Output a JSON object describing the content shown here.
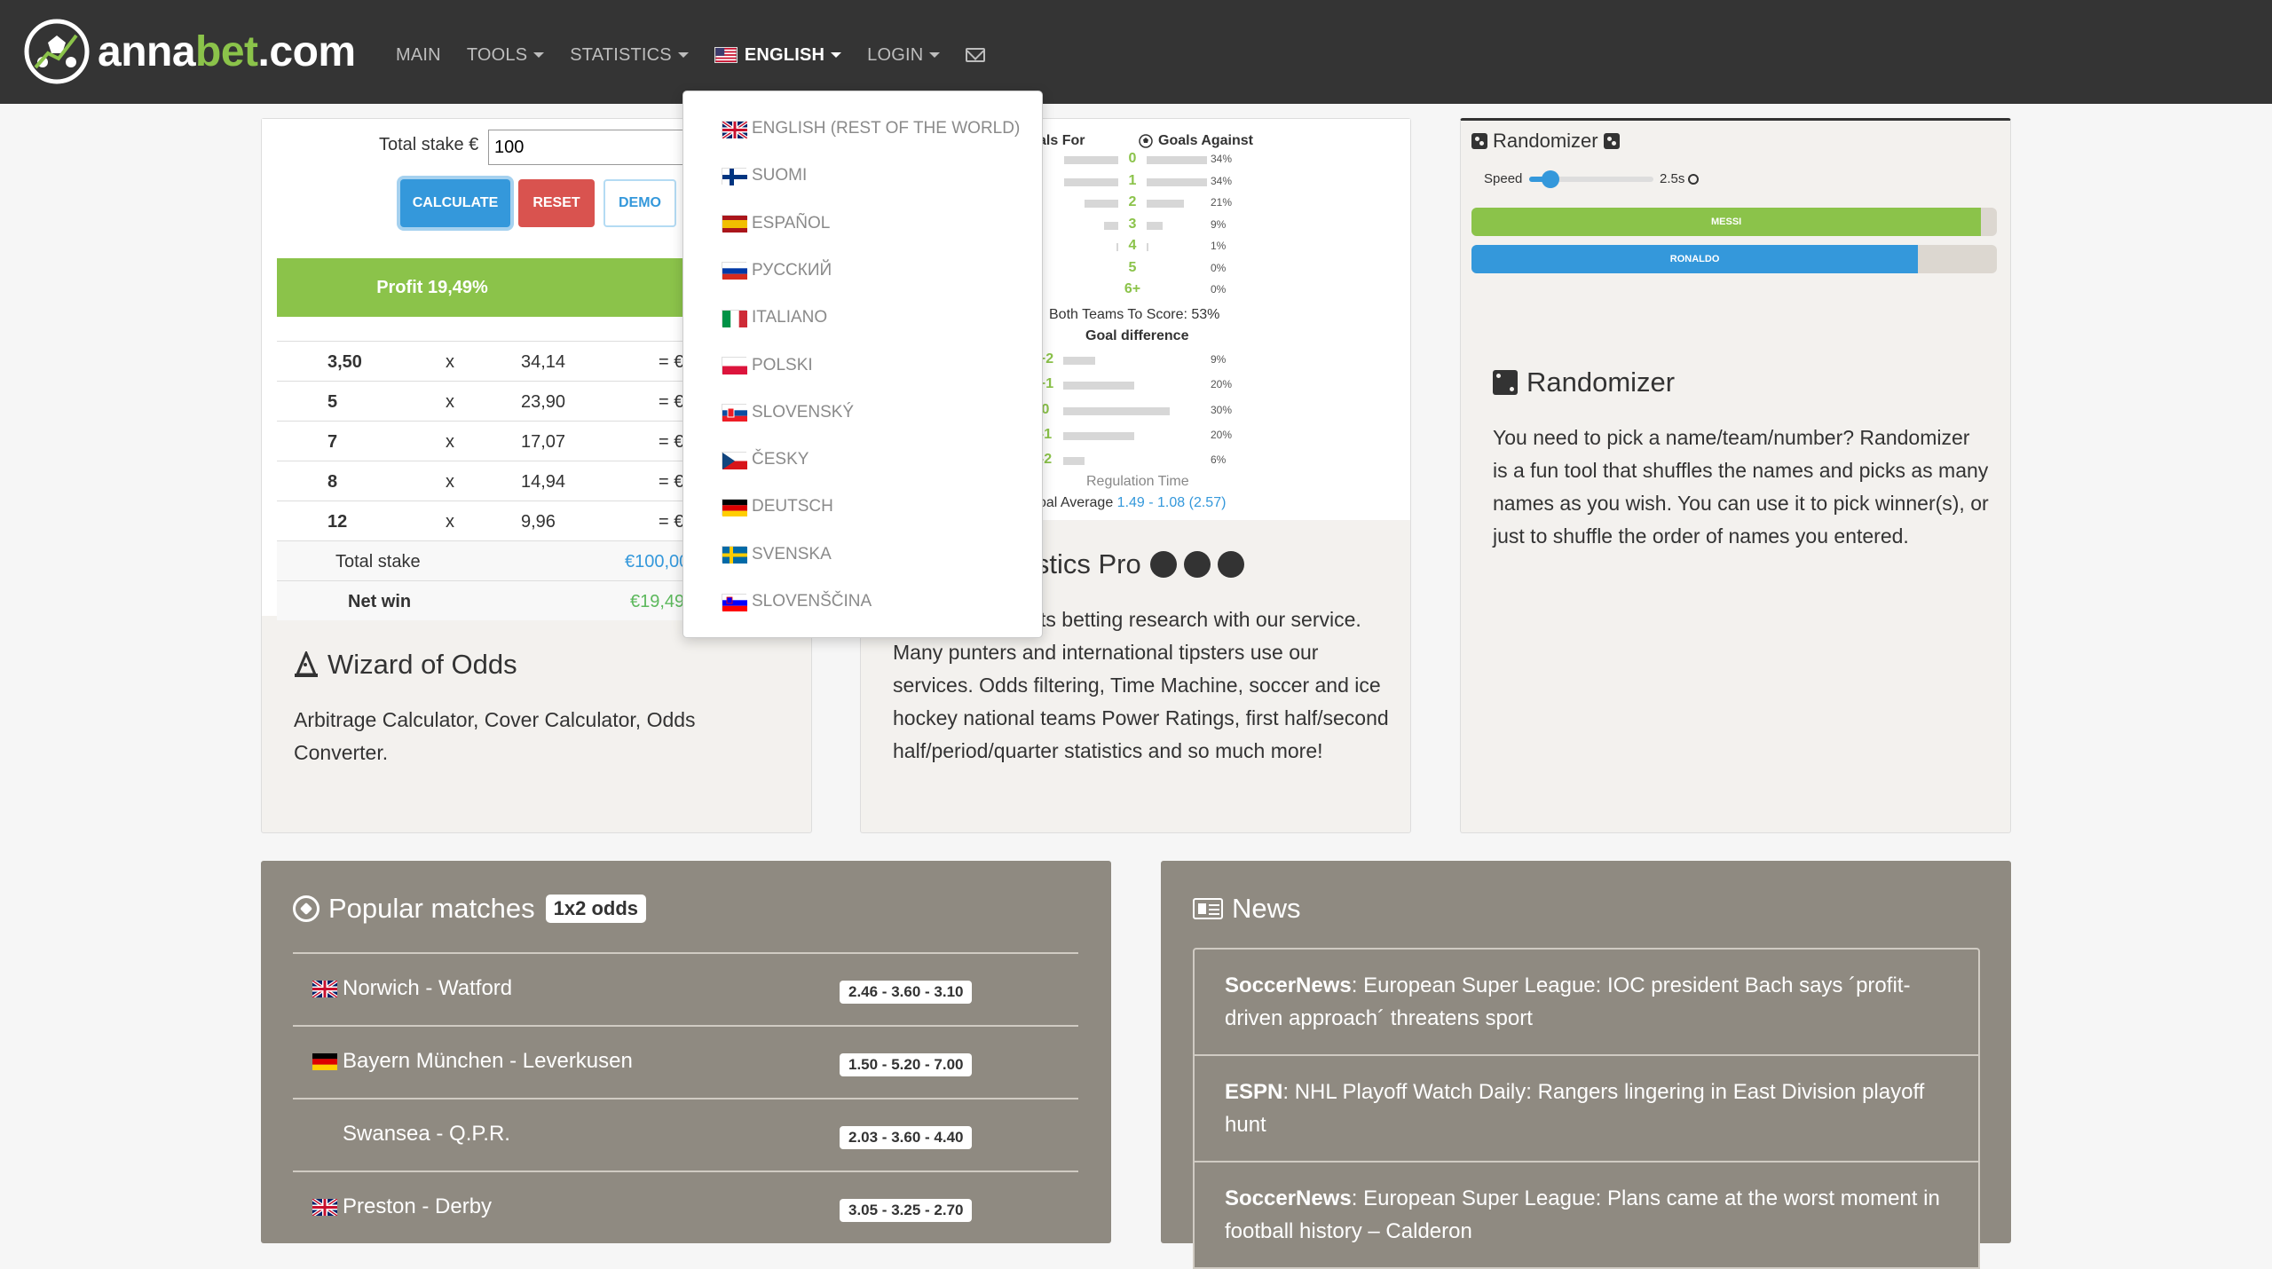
{
  "brand": {
    "name_plain": "anna",
    "name_accent": "bet",
    "name_suffix": ".com"
  },
  "nav": {
    "main": "MAIN",
    "tools": "TOOLS",
    "statistics": "STATISTICS",
    "language": "ENGLISH",
    "login": "LOGIN"
  },
  "languages": [
    {
      "label": "ENGLISH (REST OF THE WORLD)",
      "flag": "gb"
    },
    {
      "label": "SUOMI",
      "flag": "fi"
    },
    {
      "label": "ESPAÑOL",
      "flag": "es"
    },
    {
      "label": "РУССКИЙ",
      "flag": "ru"
    },
    {
      "label": "ITALIANO",
      "flag": "it"
    },
    {
      "label": "POLSKI",
      "flag": "pl"
    },
    {
      "label": "SLOVENSKÝ",
      "flag": "sk"
    },
    {
      "label": "ČESKY",
      "flag": "cz"
    },
    {
      "label": "DEUTSCH",
      "flag": "de"
    },
    {
      "label": "SVENSKA",
      "flag": "se"
    },
    {
      "label": "SLOVENŠČINA",
      "flag": "si"
    }
  ],
  "calculator": {
    "stake_label": "Total stake €",
    "stake_value": "100",
    "calculate": "CALCULATE",
    "reset": "RESET",
    "demo": "DEMO",
    "profit": "Profit 19,49%",
    "rows": [
      {
        "odd": "3,50",
        "x": "x",
        "val": "34,14",
        "eq": "= €"
      },
      {
        "odd": "5",
        "x": "x",
        "val": "23,90",
        "eq": "= €"
      },
      {
        "odd": "7",
        "x": "x",
        "val": "17,07",
        "eq": "= €"
      },
      {
        "odd": "8",
        "x": "x",
        "val": "14,94",
        "eq": "= €"
      },
      {
        "odd": "12",
        "x": "x",
        "val": "9,96",
        "eq": "= €"
      }
    ],
    "total_label": "Total stake",
    "total_value": "€100,00",
    "net_label": "Net win",
    "net_value": "€19,49"
  },
  "wizard": {
    "title": "Wizard of Odds",
    "text": "Arbitrage Calculator, Cover Calculator, Odds Converter."
  },
  "stats": {
    "goals_for": "als For",
    "goals_against": "Goals Against",
    "goal_rows": [
      {
        "label": "0",
        "for": 0.34,
        "against": 0.34,
        "pct": "34%"
      },
      {
        "label": "1",
        "for": 0.34,
        "against": 0.34,
        "pct": "34%"
      },
      {
        "label": "2",
        "for": 0.21,
        "against": 0.21,
        "pct": "21%"
      },
      {
        "label": "3",
        "for": 0.09,
        "against": 0.09,
        "pct": "9%"
      },
      {
        "label": "4",
        "for": 0.01,
        "against": 0.01,
        "pct": "1%"
      },
      {
        "label": "5",
        "for": 0,
        "against": 0,
        "pct": "0%"
      },
      {
        "label": "6+",
        "for": 0,
        "against": 0,
        "pct": "0%"
      }
    ],
    "btts": "Both Teams To Score: 53%",
    "goal_difference": "Goal difference",
    "diff_rows": [
      {
        "label": "+2",
        "value": 0.09,
        "pct": "9%"
      },
      {
        "label": "+1",
        "value": 0.2,
        "pct": "20%"
      },
      {
        "label": "0",
        "value": 0.3,
        "pct": "30%"
      },
      {
        "label": "-1",
        "value": 0.2,
        "pct": "20%"
      },
      {
        "label": "-2",
        "value": 0.06,
        "pct": "6%"
      }
    ],
    "regulation": "Regulation Time",
    "average_label": "oal Average",
    "average_value": "1.49 - 1.08 (2.57)",
    "title": "istics Pro",
    "text": "ts betting research with our service. Many punters and international tipsters use our services. Odds filtering, Time Machine, soccer and ice hockey national teams Power Ratings, first half/second half/period/quarter statistics and so much more!"
  },
  "randomizer": {
    "small_title": "Randomizer",
    "speed_label": "Speed",
    "speed_value": "2.5s",
    "speed_fraction": 0.17,
    "bars": [
      {
        "name": "MESSI",
        "fill": 0.97,
        "color": "#8bc34a"
      },
      {
        "name": "RONALDO",
        "fill": 0.85,
        "color": "#3498db"
      }
    ],
    "title": "Randomizer",
    "text": "You need to pick a name/team/number? Randomizer is a fun tool that shuffles the names and picks as many names as you wish. You can use it to pick winner(s), or just to shuffle the order of names you entered."
  },
  "popular": {
    "title": "Popular matches",
    "badge": "1x2 odds",
    "matches": [
      {
        "name": "Norwich - Watford",
        "odds": "2.46 - 3.60 - 3.10",
        "flag": "gb"
      },
      {
        "name": "Bayern München - Leverkusen",
        "odds": "1.50 - 5.20 - 7.00",
        "flag": "de"
      },
      {
        "name": "Swansea - Q.P.R.",
        "odds": "2.03 - 3.60 - 4.40",
        "flag": "none"
      },
      {
        "name": "Preston - Derby",
        "odds": "3.05 - 3.25 - 2.70",
        "flag": "gb"
      }
    ]
  },
  "news": {
    "title": "News",
    "items": [
      {
        "source": "SoccerNews",
        "text": ": European Super League: IOC president Bach says ´profit-driven approach´ threatens sport"
      },
      {
        "source": "ESPN",
        "text": ": NHL Playoff Watch Daily: Rangers lingering in East Division playoff hunt"
      },
      {
        "source": "SoccerNews",
        "text": ": European Super League: Plans came at the worst moment in football history – Calderon"
      }
    ]
  },
  "colors": {
    "green": "#8bc34a",
    "blue": "#3498db",
    "red": "#d9534f",
    "nav_bg": "#343434",
    "dark_card": "#8f8a81"
  }
}
